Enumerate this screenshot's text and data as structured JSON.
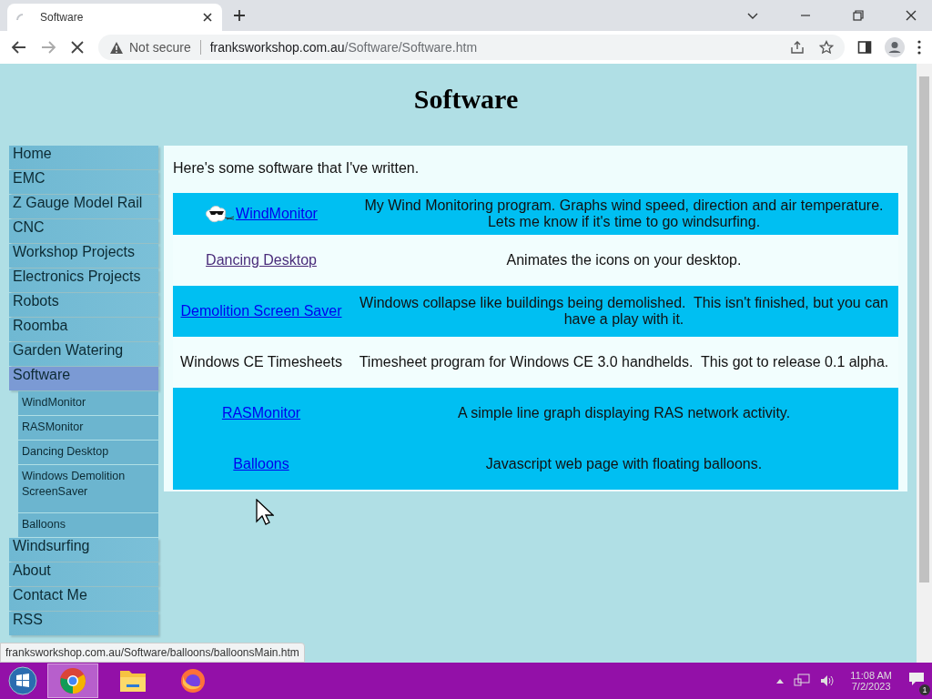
{
  "browser": {
    "tab": {
      "title": "Software",
      "loading": true
    },
    "address": {
      "security": "Not secure",
      "host": "franksworkshop.com.au",
      "path": "/Software/Software.htm"
    },
    "status_url": "franksworkshop.com.au/Software/balloons/balloonsMain.htm"
  },
  "page": {
    "title": "Software",
    "intro": "Here's some software that I've written.",
    "sidebar": [
      {
        "label": "Home",
        "selected": false
      },
      {
        "label": "EMC",
        "selected": false
      },
      {
        "label": "Z Gauge Model Rail",
        "selected": false
      },
      {
        "label": "CNC",
        "selected": false
      },
      {
        "label": "Workshop Projects",
        "selected": false
      },
      {
        "label": "Electronics Projects",
        "selected": false
      },
      {
        "label": "Robots",
        "selected": false
      },
      {
        "label": "Roomba",
        "selected": false
      },
      {
        "label": "Garden Watering",
        "selected": false
      },
      {
        "label": "Software",
        "selected": true,
        "children": [
          {
            "label": "WindMonitor"
          },
          {
            "label": "RASMonitor"
          },
          {
            "label": "Dancing Desktop"
          },
          {
            "label": "Windows Demolition ScreenSaver"
          },
          {
            "label": "Balloons"
          }
        ]
      },
      {
        "label": "Windsurfing",
        "selected": false
      },
      {
        "label": "About",
        "selected": false
      },
      {
        "label": "Contact Me",
        "selected": false
      },
      {
        "label": "RSS",
        "selected": false
      }
    ],
    "programs": [
      {
        "name": "WindMonitor",
        "kind": "link",
        "visited": false,
        "highlighted": true,
        "has_icon": true,
        "description": "My Wind Monitoring program. Graphs wind speed, direction and air temperature. Lets me know if it's time to go windsurfing."
      },
      {
        "name": "Dancing Desktop",
        "kind": "link",
        "visited": true,
        "highlighted": false,
        "has_icon": false,
        "description": "Animates the icons on your desktop."
      },
      {
        "name": "Demolition Screen Saver",
        "kind": "link",
        "visited": false,
        "highlighted": true,
        "has_icon": false,
        "description": "Windows collapse like buildings being demolished.  This isn't finished, but you can have a play with it."
      },
      {
        "name": "Windows CE Timesheets",
        "kind": "text",
        "highlighted": false,
        "has_icon": false,
        "description": "Timesheet program for Windows CE 3.0 handhelds.  This got to release 0.1 alpha."
      },
      {
        "name": "RASMonitor",
        "kind": "link",
        "visited": false,
        "highlighted": true,
        "has_icon": false,
        "description": "A simple line graph displaying RAS network activity."
      },
      {
        "name": "Balloons",
        "kind": "link",
        "visited": false,
        "highlighted": true,
        "has_icon": false,
        "description": "Javascript web page with floating balloons."
      }
    ]
  },
  "taskbar": {
    "apps": [
      {
        "kind": "chrome",
        "selected": true
      },
      {
        "kind": "explorer",
        "selected": false
      },
      {
        "kind": "firefox",
        "selected": false
      }
    ],
    "time": "11:08 AM",
    "date": "7/2/2023",
    "notifications": "1"
  }
}
